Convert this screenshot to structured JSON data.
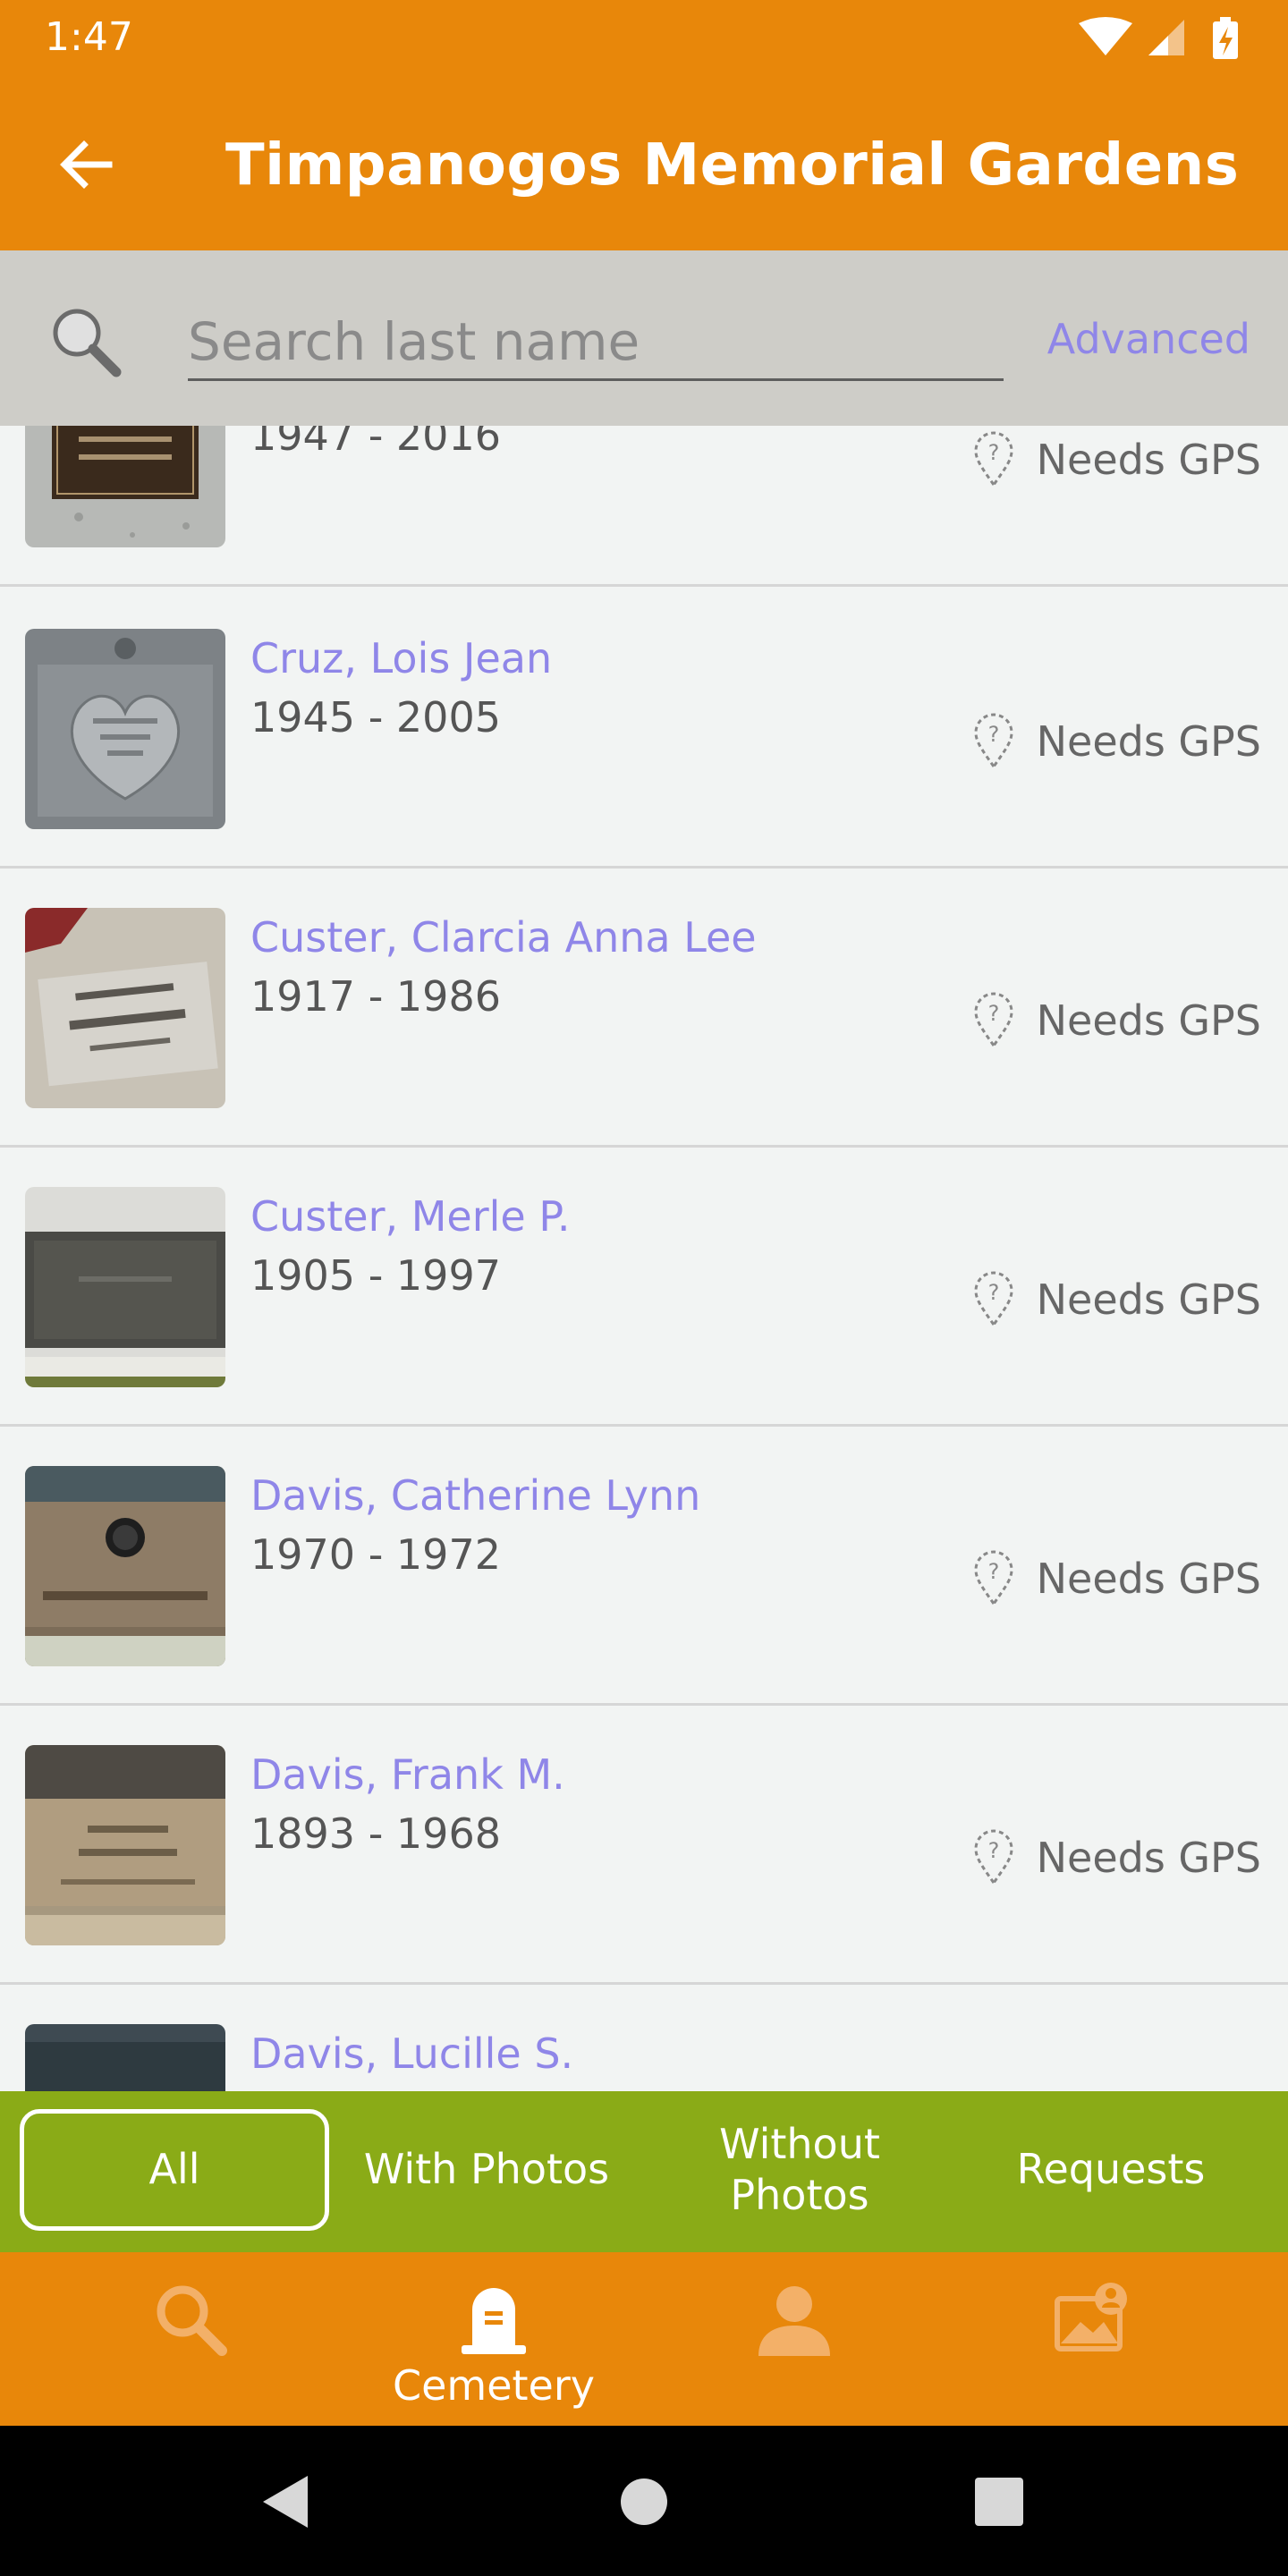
{
  "status_bar": {
    "time": "1:47"
  },
  "app_bar": {
    "title": "Timpanogos Memorial Gardens"
  },
  "search": {
    "placeholder": "Search last name",
    "advanced_label": "Advanced"
  },
  "records": [
    {
      "name": "",
      "dates": "1947 - 2016",
      "gps_status": "Needs GPS"
    },
    {
      "name": "Cruz, Lois Jean",
      "dates": "1945 - 2005",
      "gps_status": "Needs GPS"
    },
    {
      "name": "Custer, Clarcia Anna Lee",
      "dates": "1917 - 1986",
      "gps_status": "Needs GPS"
    },
    {
      "name": "Custer, Merle P.",
      "dates": "1905 - 1997",
      "gps_status": "Needs GPS"
    },
    {
      "name": "Davis, Catherine Lynn",
      "dates": "1970 - 1972",
      "gps_status": "Needs GPS"
    },
    {
      "name": "Davis, Frank M.",
      "dates": "1893 - 1968",
      "gps_status": "Needs GPS"
    },
    {
      "name": "Davis, Lucille S.",
      "dates": "",
      "gps_status": ""
    }
  ],
  "filters": [
    {
      "label": "All",
      "active": true
    },
    {
      "label": "With Photos",
      "active": false
    },
    {
      "label": "Without Photos",
      "active": false
    },
    {
      "label": "Requests",
      "active": false
    }
  ],
  "bottom_nav": [
    {
      "icon": "search-icon",
      "label": ""
    },
    {
      "icon": "tombstone-icon",
      "label": "Cemetery"
    },
    {
      "icon": "person-icon",
      "label": ""
    },
    {
      "icon": "photo-request-icon",
      "label": ""
    }
  ],
  "colors": {
    "primary_orange": "#e8870a",
    "filter_green": "#8aab17",
    "name_link": "#8f86e8",
    "search_bg": "#cecdc8",
    "list_bg": "#f2f4f3"
  }
}
